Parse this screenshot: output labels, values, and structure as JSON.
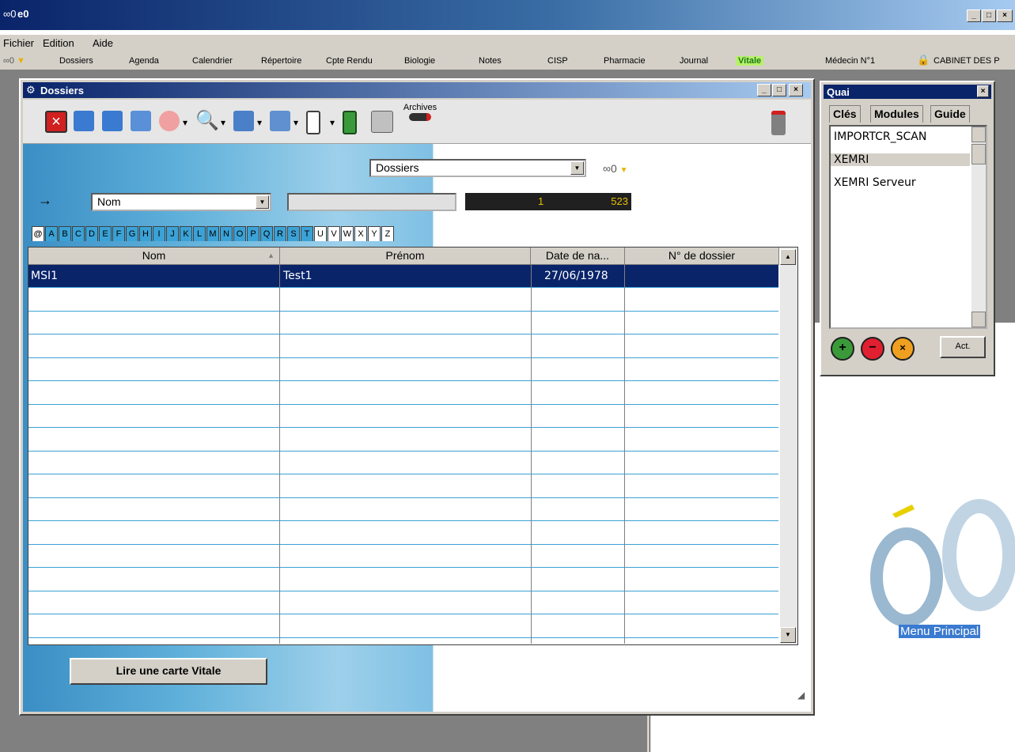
{
  "app": {
    "title": "e0",
    "logo_glyph": "∞0"
  },
  "window_buttons": {
    "min": "_",
    "max": "□",
    "close": "×"
  },
  "menu": [
    "Fichier",
    "Edition",
    "Aide"
  ],
  "modules": [
    "Dossiers",
    "Agenda",
    "Calendrier",
    "Répertoire",
    "Cpte Rendu",
    "Biologie",
    "Notes",
    "CISP",
    "Pharmacie",
    "Journal",
    "Vitale",
    "Médecin N°1",
    "CABINET DES P"
  ],
  "dossiers": {
    "title": "Dossiers",
    "archives_label": "Archives",
    "view_combo": "Dossiers",
    "search_field_combo": "Nom",
    "search_value": "",
    "counter_current": "1",
    "counter_total": "523",
    "arrow": "→",
    "alphabet": [
      "@",
      "A",
      "B",
      "C",
      "D",
      "E",
      "F",
      "G",
      "H",
      "I",
      "J",
      "K",
      "L",
      "M",
      "N",
      "O",
      "P",
      "Q",
      "R",
      "S",
      "T",
      "U",
      "V",
      "W",
      "X",
      "Y",
      "Z"
    ],
    "columns": [
      "Nom",
      "Prénom",
      "Date de na...",
      "N° de dossier"
    ],
    "rows": [
      {
        "nom": "MSI1",
        "prenom": "Test1",
        "date": "27/06/1978",
        "num": ""
      }
    ],
    "vitale_button": "Lire une carte Vitale"
  },
  "quai": {
    "title": "Quai",
    "tabs": [
      "Clés",
      "Modules",
      "Guide"
    ],
    "items": [
      "IMPORTCR_SCAN",
      "XEMRI",
      "XEMRI Serveur"
    ],
    "selected_index": 1,
    "act_button": "Act."
  },
  "logo": {
    "caption": "Menu Principal"
  },
  "colors": {
    "selection": "#0a246a",
    "grid_line": "#3aa2d6",
    "counter_text": "#e8c000"
  }
}
